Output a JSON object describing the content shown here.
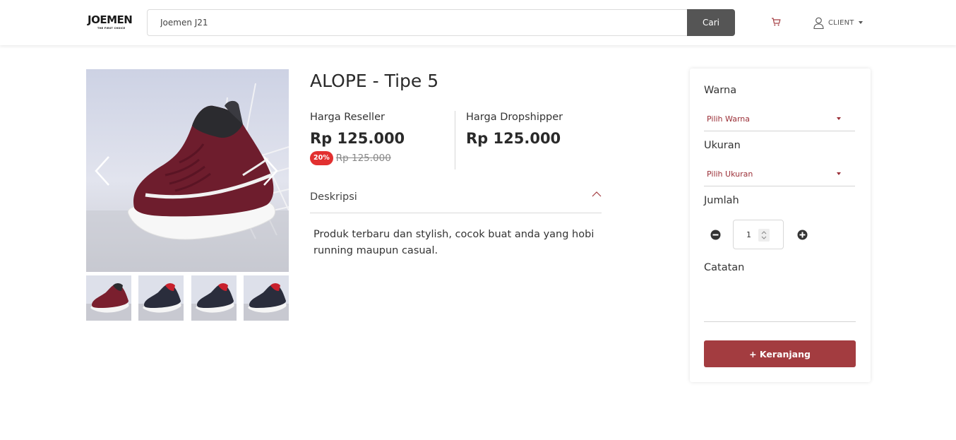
{
  "header": {
    "logo_text": "JOEMEN",
    "logo_tagline": "THE FIRST CHOICE",
    "search": {
      "value": "Joemen J21",
      "button_label": "Cari"
    },
    "user_label": "CLIENT"
  },
  "product": {
    "title": "ALOPE - Tipe 5",
    "reseller_label": "Harga Reseller",
    "reseller_price": "Rp 125.000",
    "discount_badge": "20%",
    "old_price": "Rp 125.000",
    "dropship_label": "Harga Dropshipper",
    "dropship_price": "Rp 125.000",
    "description_label": "Deskripsi",
    "description_text": "Produk terbaru dan stylish, cocok buat anda yang hobi running maupun casual."
  },
  "gallery": {
    "thumbnails": [
      {
        "color": "#7a1f2e"
      },
      {
        "color": "#2a2d3c"
      },
      {
        "color": "#2a2d3c"
      },
      {
        "color": "#2a2d3c"
      }
    ]
  },
  "options": {
    "color_label": "Warna",
    "color_placeholder": "Pilih Warna",
    "size_label": "Ukuran",
    "size_placeholder": "Pilih Ukuran",
    "quantity_label": "Jumlah",
    "quantity_value": "1",
    "note_label": "Catatan",
    "add_to_cart_label": "+ Keranjang"
  },
  "colors": {
    "accent": "#a33c40",
    "search_button": "#555555",
    "discount": "#e23030"
  }
}
